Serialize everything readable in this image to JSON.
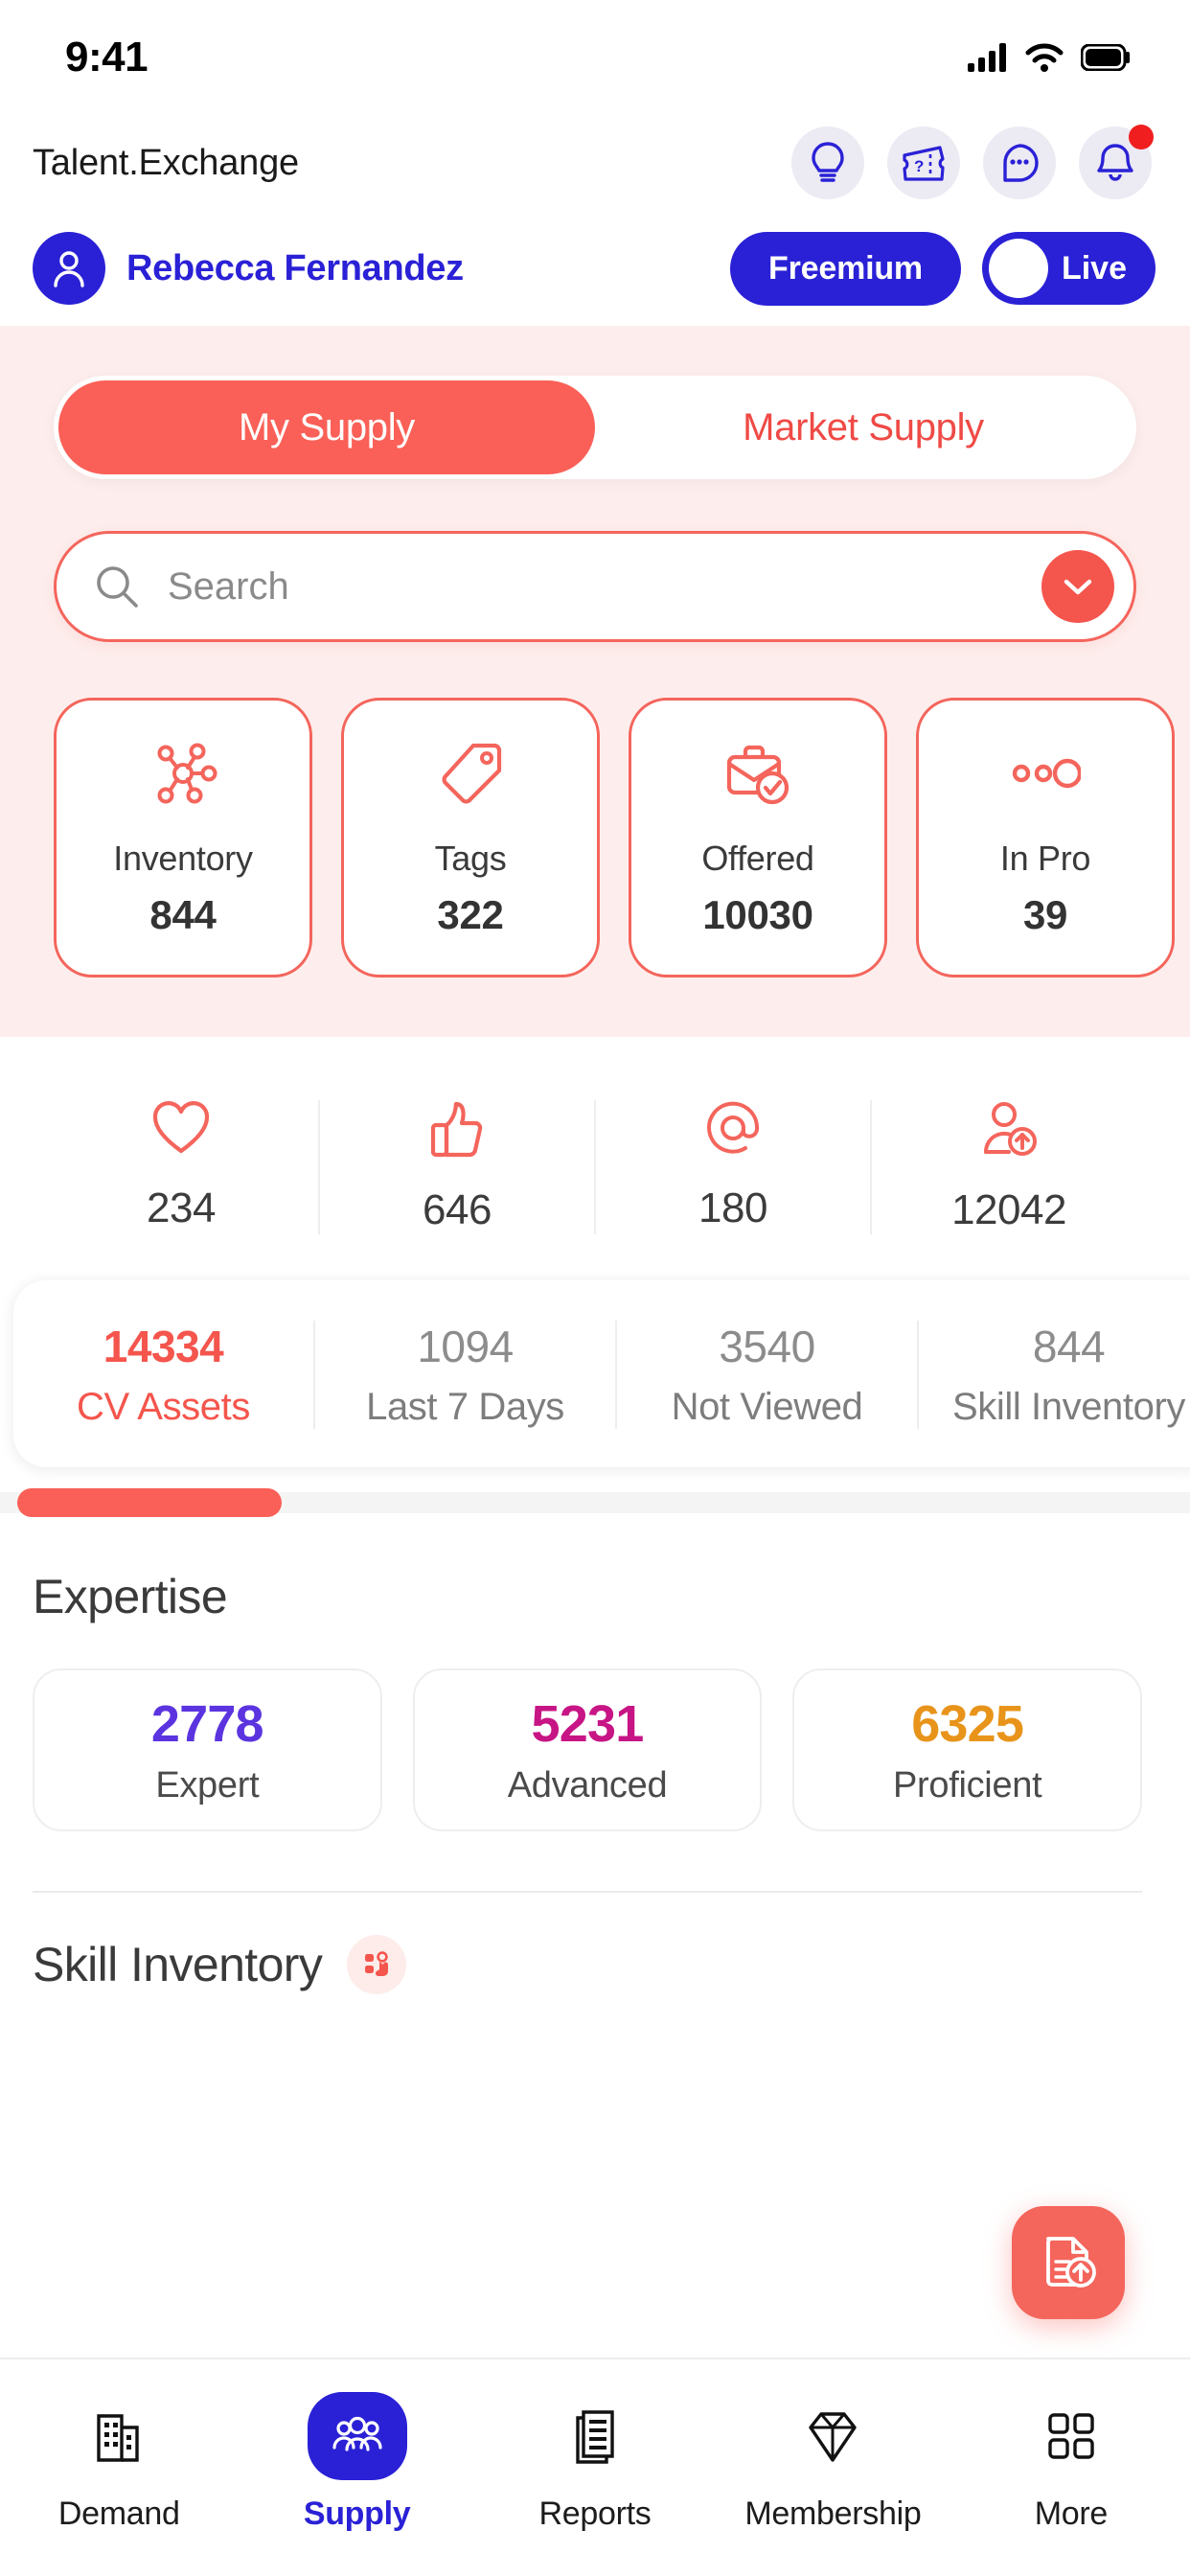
{
  "status_bar": {
    "time": "9:41",
    "icons": [
      "cellular-signal-icon",
      "wifi-icon",
      "battery-icon"
    ]
  },
  "header": {
    "brand": "Talent.Exchange",
    "icons": [
      {
        "name": "lightbulb-icon",
        "badge": false
      },
      {
        "name": "support-ticket-icon",
        "badge": false
      },
      {
        "name": "chat-bubble-icon",
        "badge": false
      },
      {
        "name": "notification-bell-icon",
        "badge": true
      }
    ]
  },
  "profile": {
    "avatar_icon": "user-avatar-icon",
    "name": "Rebecca Fernandez",
    "plan_label": "Freemium",
    "live_label": "Live",
    "live_on": false
  },
  "tabs": {
    "items": [
      {
        "label": "My Supply",
        "active": true
      },
      {
        "label": "Market Supply",
        "active": false
      }
    ]
  },
  "search": {
    "placeholder": "Search",
    "value": "",
    "icon": "search-icon",
    "chevron_icon": "chevron-down-icon"
  },
  "stat_cards": [
    {
      "icon": "network-nodes-icon",
      "label": "Inventory",
      "value": "844"
    },
    {
      "icon": "tag-icon",
      "label": "Tags",
      "value": "322"
    },
    {
      "icon": "briefcase-check-icon",
      "label": "Offered",
      "value": "10030"
    },
    {
      "icon": "in-progress-dots-icon",
      "label": "In Pro",
      "value": "39"
    }
  ],
  "engagement": [
    {
      "icon": "heart-icon",
      "value": "234"
    },
    {
      "icon": "thumbs-up-icon",
      "value": "646"
    },
    {
      "icon": "at-mention-icon",
      "value": "180"
    },
    {
      "icon": "user-add-icon",
      "value": "12042"
    }
  ],
  "cv_assets": [
    {
      "value": "14334",
      "label": "CV Assets",
      "primary": true
    },
    {
      "value": "1094",
      "label": "Last 7 Days",
      "primary": false
    },
    {
      "value": "3540",
      "label": "Not Viewed",
      "primary": false
    },
    {
      "value": "844",
      "label": "Skill Inventory",
      "primary": false
    }
  ],
  "expertise": {
    "title": "Expertise",
    "cards": [
      {
        "value": "2778",
        "label": "Expert",
        "color": "#5b34e0"
      },
      {
        "value": "5231",
        "label": "Advanced",
        "color": "#c71585"
      },
      {
        "value": "6325",
        "label": "Proficient",
        "color": "#e8941a"
      }
    ]
  },
  "skill_inventory": {
    "title": "Skill Inventory",
    "badge_icon": "skill-hand-icon"
  },
  "fab": {
    "icon": "document-upload-icon"
  },
  "bottom_nav": [
    {
      "icon": "building-icon",
      "label": "Demand",
      "active": false
    },
    {
      "icon": "people-group-icon",
      "label": "Supply",
      "active": true
    },
    {
      "icon": "reports-document-icon",
      "label": "Reports",
      "active": false
    },
    {
      "icon": "diamond-icon",
      "label": "Membership",
      "active": false
    },
    {
      "icon": "grid-squares-icon",
      "label": "More",
      "active": false
    }
  ],
  "colors": {
    "brand_blue": "#2a21d6",
    "accent_coral": "#f4554c",
    "pink_bg": "#fdeeed",
    "notification_red": "#f01e1e"
  }
}
